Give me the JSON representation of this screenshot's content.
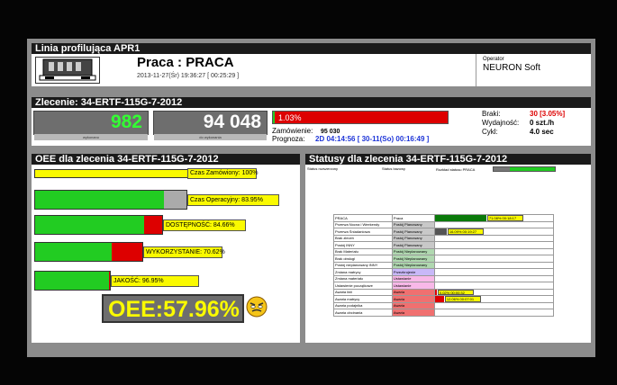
{
  "header": {
    "line_title": "Linia profilująca APR1",
    "state": "Praca : PRACA",
    "timestamp": "2013-11-27(Śr) 19:36:27  [ 00:25:29 ]",
    "operator_label": "Operator",
    "operator_name": "NEURON Soft"
  },
  "order": {
    "title": "Zlecenie: 34-ERTF-115G-7-2012",
    "produced": "982",
    "produced_caption": "wykonano",
    "ordered": "94 048",
    "ordered_caption": "do wykonania",
    "progress_text": "1.03%",
    "progress_pct": 1.03,
    "order_label": "Zamówienie:",
    "order_value": "95 030",
    "forecast_label": "Prognoza:",
    "forecast_value": "2D 04:14:56  [ 30-11(So) 00:16:49 ]",
    "scrap_label": "Braki:",
    "scrap_value": "30 [3.05%]",
    "efficiency_label": "Wydajność:",
    "efficiency_value": "0 szt./h",
    "cycle_label": "Cykl:",
    "cycle_value": "4.0 sec"
  },
  "oee": {
    "title": "OEE dla zlecenia 34-ERTF-115G-7-2012",
    "rows": [
      {
        "label": "Czas Zamówiony: 100%",
        "pct": 100
      },
      {
        "label": "Czas Operacyjny: 83.95%",
        "pct": 83.95
      },
      {
        "label": "DOSTĘPNOŚĆ: 84.66%",
        "pct": 84.66
      },
      {
        "label": "WYKORZYSTANIE: 70.62%",
        "pct": 70.62
      },
      {
        "label": "JAKOŚĆ: 96.95%",
        "pct": 96.95
      }
    ],
    "total": "OEE:57.96%",
    "mood_icon": "angry-face-icon",
    "colors": {
      "ok": "#22cc22",
      "loss": "#dd0000",
      "label": "#fafa00",
      "total_text": "#fafa00"
    }
  },
  "statuses": {
    "title": "Statusy dla zlecenia 34-ERTF-115G-7-2012",
    "col_status": "Status rozszerzony",
    "col_base": "Status bazowy",
    "col_split": "Rozkład statusu PRACA",
    "rows": [
      {
        "name": "PRACA",
        "base": "Praca",
        "kind": "work",
        "pct": 71.08,
        "label": "71.08%  00:18:17"
      },
      {
        "name": "Przerwa Nocna i Weekendy",
        "base": "Postój Planowany",
        "kind": "planned",
        "pct": 0,
        "label": ""
      },
      {
        "name": "Przerwa Śniadaniowa",
        "base": "Postój Planowany",
        "kind": "planned",
        "pct": 16.09,
        "label": "16.09%  00:19:27"
      },
      {
        "name": "Brak zleceń",
        "base": "Postój Planowany",
        "kind": "planned",
        "pct": 0,
        "label": ""
      },
      {
        "name": "Postój INNY",
        "base": "Postój Planowany",
        "kind": "planned",
        "pct": 0,
        "label": ""
      },
      {
        "name": "Brak Materiału",
        "base": "Postój Nieplanowany",
        "kind": "unplanned",
        "pct": 0,
        "label": ""
      },
      {
        "name": "Brak obsługi",
        "base": "Postój Nieplanowany",
        "kind": "unplanned",
        "pct": 0,
        "label": ""
      },
      {
        "name": "Postój nieplanowany INNY",
        "base": "Postój Nieplanowany",
        "kind": "unplanned",
        "pct": 0,
        "label": ""
      },
      {
        "name": "Zmiana matrycy",
        "base": "Przezbrojenie",
        "kind": "changeover",
        "pct": 0,
        "label": ""
      },
      {
        "name": "Zmiana materiału",
        "base": "Ustawianie",
        "kind": "setup",
        "pct": 0,
        "label": ""
      },
      {
        "name": "Ustawienie początkowe",
        "base": "Ustawianie",
        "kind": "setup",
        "pct": 0,
        "label": ""
      },
      {
        "name": "Awaria linii",
        "base": "Awaria",
        "kind": "failure",
        "pct": 0.02,
        "label": "0.02%  00:00:32"
      },
      {
        "name": "Awaria matrycy",
        "base": "Awaria",
        "kind": "failure",
        "pct": 12.06,
        "label": "12.06%  00:07:01"
      },
      {
        "name": "Awaria podajnika",
        "base": "Awaria",
        "kind": "failure",
        "pct": 0,
        "label": ""
      },
      {
        "name": "Awaria obcinania",
        "base": "Awaria",
        "kind": "failure",
        "pct": 0,
        "label": ""
      }
    ],
    "base_colors": {
      "work": "#ffffff",
      "planned": "#c8c8c8",
      "unplanned": "#b0d8b0",
      "changeover": "#c8b8f8",
      "setup": "#f8b8e8",
      "failure": "#f07070"
    },
    "bar_colors": {
      "work": "#0a7a0a",
      "planned": "#555555",
      "failure": "#dd0000"
    }
  }
}
